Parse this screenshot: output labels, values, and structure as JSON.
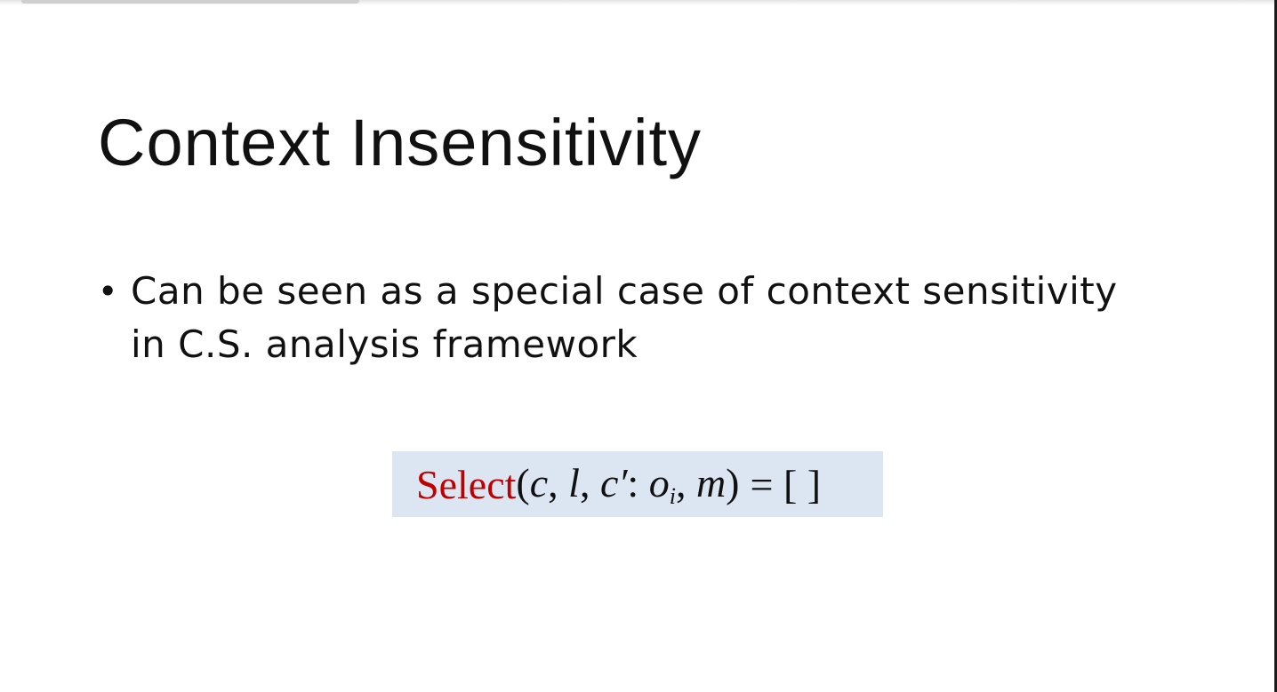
{
  "slide": {
    "title": "Context Insensitivity",
    "bullets": [
      {
        "marker": "•",
        "text": "Can be seen as a special case of context sensitivity in C.S. analysis framework"
      }
    ],
    "formula": {
      "function_name": "Select",
      "open_paren": "(",
      "arg_c": "c",
      "comma1": ", ",
      "arg_l": "l",
      "comma2": ", ",
      "arg_c_prime": "c′",
      "colon": ": ",
      "arg_o": "o",
      "arg_o_subscript": "i",
      "comma3": ", ",
      "arg_m": "m",
      "close_paren": ")",
      "equals_result": "= [ ]"
    },
    "colors": {
      "function_name": "#c00000",
      "formula_background": "#dce6f2",
      "text": "#111111"
    }
  }
}
